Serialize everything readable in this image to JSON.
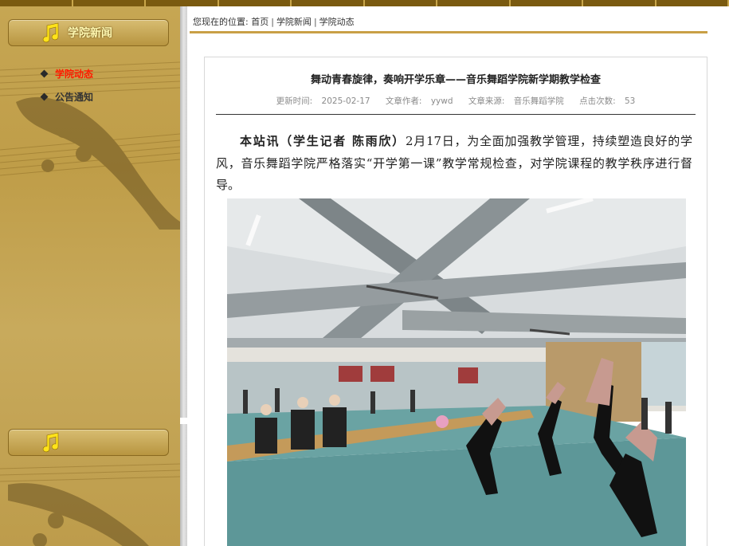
{
  "sidebar": {
    "panel1_title": "学院新闻",
    "panel2_title": "",
    "items": [
      {
        "label": "学院动态",
        "active": true
      },
      {
        "label": "公告通知",
        "active": false
      }
    ]
  },
  "breadcrumb": {
    "prefix": "您现在的位置:",
    "crumbs": [
      "首页",
      "学院新闻",
      "学院动态"
    ],
    "separator": "|"
  },
  "article": {
    "title": "舞动青春旋律，奏响开学乐章——音乐舞蹈学院新学期教学检查",
    "meta": {
      "updated_label": "更新时间:",
      "updated_value": "2025-02-17",
      "author_label": "文章作者:",
      "author_value": "yywd",
      "source_label": "文章来源:",
      "source_value": "音乐舞蹈学院",
      "hits_label": "点击次数:",
      "hits_value": "53"
    },
    "lead": "本站讯（学生记者 陈雨欣）",
    "body": "2月17日，为全面加强教学管理，持续塑造良好的学风，音乐舞蹈学院严格落实“开学第一课”教学常规检查，对学院课程的教学秩序进行督导。"
  },
  "icons": {
    "music_note": "music-note-icon",
    "bullet": "diamond-bullet-icon"
  },
  "colors": {
    "sidebar_gold": "#c6a653",
    "header_title": "#fff8b0",
    "active_item": "#ff1a00",
    "accent_rule": "#c9a046"
  }
}
